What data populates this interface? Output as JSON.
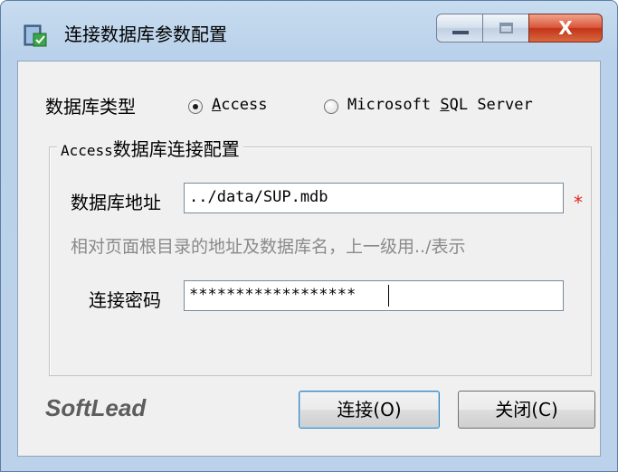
{
  "window": {
    "title": "连接数据库参数配置",
    "close_glyph": "X"
  },
  "db_type": {
    "label": "数据库类型",
    "options": [
      {
        "text_accel": "A",
        "text_rest": "ccess",
        "checked": true
      },
      {
        "text_pre": "Microsoft ",
        "text_accel": "S",
        "text_rest": "QL Server",
        "checked": false
      }
    ]
  },
  "group": {
    "legend_latin": "Access",
    "legend_cjk": "数据库连接配置"
  },
  "db_address": {
    "label": "数据库地址",
    "value": "../data/SUP.mdb",
    "required_mark": "*",
    "hint": "相对页面根目录的地址及数据库名，上一级用../表示"
  },
  "db_password": {
    "label": "连接密码",
    "value": "******************"
  },
  "footer": {
    "brand": "SoftLead",
    "connect_label": "连接(O)",
    "close_label": "关闭(C)"
  },
  "colors": {
    "required": "#e0261d",
    "hint": "#8a8a8a",
    "brand": "#5d5d5d"
  }
}
